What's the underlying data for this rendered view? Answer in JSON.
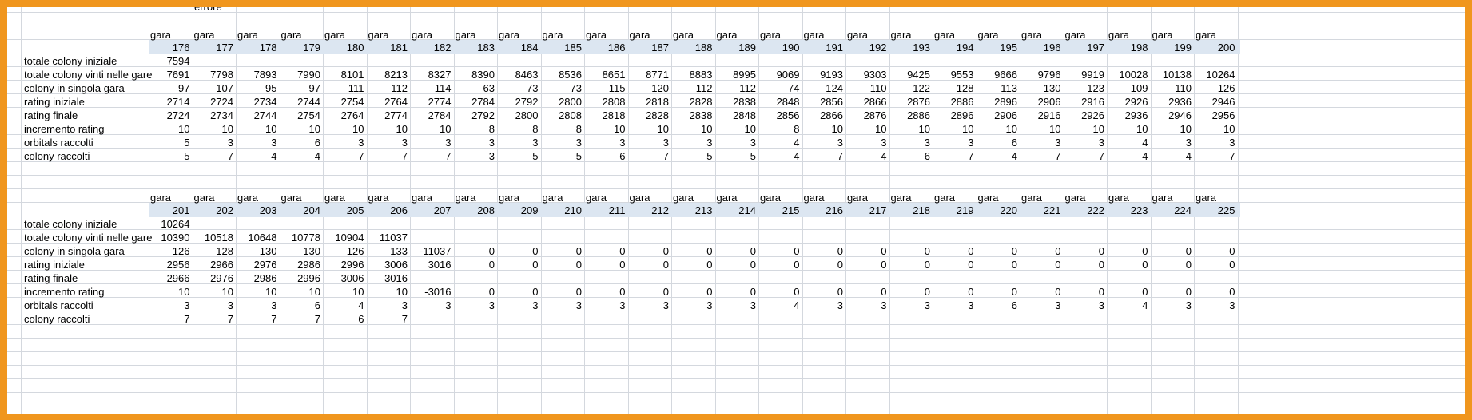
{
  "sheet": {
    "error_note": "errore",
    "col_label": "gara",
    "row_labels": [
      "totale colony iniziale",
      "totale colony vinti nelle gare",
      "colony in singola gara",
      "rating iniziale",
      "rating finale",
      "incremento rating",
      "orbitals raccolti",
      "colony raccolti"
    ],
    "blocks": [
      {
        "gara_numbers": [
          "176",
          "177",
          "178",
          "179",
          "180",
          "181",
          "182",
          "183",
          "184",
          "185",
          "186",
          "187",
          "188",
          "189",
          "190",
          "191",
          "192",
          "193",
          "194",
          "195",
          "196",
          "197",
          "198",
          "199",
          "200"
        ],
        "rows": [
          [
            "7594"
          ],
          [
            "7691",
            "7798",
            "7893",
            "7990",
            "8101",
            "8213",
            "8327",
            "8390",
            "8463",
            "8536",
            "8651",
            "8771",
            "8883",
            "8995",
            "9069",
            "9193",
            "9303",
            "9425",
            "9553",
            "9666",
            "9796",
            "9919",
            "10028",
            "10138",
            "10264"
          ],
          [
            "97",
            "107",
            "95",
            "97",
            "111",
            "112",
            "114",
            "63",
            "73",
            "73",
            "115",
            "120",
            "112",
            "112",
            "74",
            "124",
            "110",
            "122",
            "128",
            "113",
            "130",
            "123",
            "109",
            "110",
            "126"
          ],
          [
            "2714",
            "2724",
            "2734",
            "2744",
            "2754",
            "2764",
            "2774",
            "2784",
            "2792",
            "2800",
            "2808",
            "2818",
            "2828",
            "2838",
            "2848",
            "2856",
            "2866",
            "2876",
            "2886",
            "2896",
            "2906",
            "2916",
            "2926",
            "2936",
            "2946"
          ],
          [
            "2724",
            "2734",
            "2744",
            "2754",
            "2764",
            "2774",
            "2784",
            "2792",
            "2800",
            "2808",
            "2818",
            "2828",
            "2838",
            "2848",
            "2856",
            "2866",
            "2876",
            "2886",
            "2896",
            "2906",
            "2916",
            "2926",
            "2936",
            "2946",
            "2956"
          ],
          [
            "10",
            "10",
            "10",
            "10",
            "10",
            "10",
            "10",
            "8",
            "8",
            "8",
            "10",
            "10",
            "10",
            "10",
            "8",
            "10",
            "10",
            "10",
            "10",
            "10",
            "10",
            "10",
            "10",
            "10",
            "10"
          ],
          [
            "5",
            "3",
            "3",
            "6",
            "3",
            "3",
            "3",
            "3",
            "3",
            "3",
            "3",
            "3",
            "3",
            "3",
            "4",
            "3",
            "3",
            "3",
            "3",
            "6",
            "3",
            "3",
            "4",
            "3",
            "3"
          ],
          [
            "5",
            "7",
            "4",
            "4",
            "7",
            "7",
            "7",
            "3",
            "5",
            "5",
            "6",
            "7",
            "5",
            "5",
            "4",
            "7",
            "4",
            "6",
            "7",
            "4",
            "7",
            "7",
            "4",
            "4",
            "7"
          ]
        ]
      },
      {
        "gara_numbers": [
          "201",
          "202",
          "203",
          "204",
          "205",
          "206",
          "207",
          "208",
          "209",
          "210",
          "211",
          "212",
          "213",
          "214",
          "215",
          "216",
          "217",
          "218",
          "219",
          "220",
          "221",
          "222",
          "223",
          "224",
          "225"
        ],
        "rows": [
          [
            "10264"
          ],
          [
            "10390",
            "10518",
            "10648",
            "10778",
            "10904",
            "11037"
          ],
          [
            "126",
            "128",
            "130",
            "130",
            "126",
            "133",
            "-11037",
            "0",
            "0",
            "0",
            "0",
            "0",
            "0",
            "0",
            "0",
            "0",
            "0",
            "0",
            "0",
            "0",
            "0",
            "0",
            "0",
            "0",
            "0"
          ],
          [
            "2956",
            "2966",
            "2976",
            "2986",
            "2996",
            "3006",
            "3016",
            "0",
            "0",
            "0",
            "0",
            "0",
            "0",
            "0",
            "0",
            "0",
            "0",
            "0",
            "0",
            "0",
            "0",
            "0",
            "0",
            "0",
            "0"
          ],
          [
            "2966",
            "2976",
            "2986",
            "2996",
            "3006",
            "3016"
          ],
          [
            "10",
            "10",
            "10",
            "10",
            "10",
            "10",
            "-3016",
            "0",
            "0",
            "0",
            "0",
            "0",
            "0",
            "0",
            "0",
            "0",
            "0",
            "0",
            "0",
            "0",
            "0",
            "0",
            "0",
            "0",
            "0"
          ],
          [
            "3",
            "3",
            "3",
            "6",
            "4",
            "3",
            "3",
            "3",
            "3",
            "3",
            "3",
            "3",
            "3",
            "3",
            "4",
            "3",
            "3",
            "3",
            "3",
            "6",
            "3",
            "3",
            "4",
            "3",
            "3"
          ],
          [
            "7",
            "7",
            "7",
            "7",
            "6",
            "7"
          ]
        ]
      }
    ],
    "colors": {
      "frame": "#f0961e",
      "header_band": "#dce6f1",
      "gridline": "#d4d8de"
    }
  }
}
